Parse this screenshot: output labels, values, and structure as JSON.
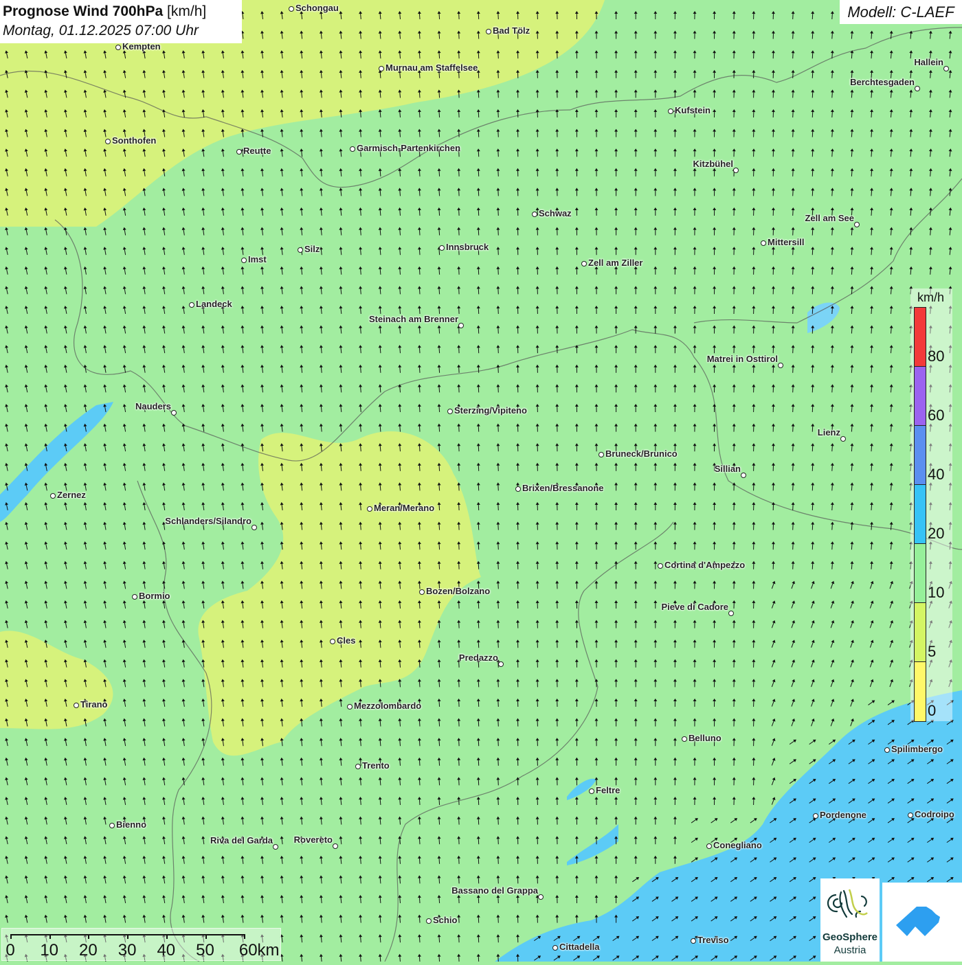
{
  "header": {
    "title_bold": "Prognose Wind 700hPa",
    "title_unit": "[km/h]",
    "datetime": "Montag, 01.12.2025 07:00 Uhr",
    "model": "Modell: C-LAEF"
  },
  "colors": {
    "base_green": "#a2eda0",
    "yellow_green": "#d6f27c",
    "blue": "#5ccbf6",
    "lake": "#3fa8f0",
    "arrow": "#111111"
  },
  "legend": {
    "unit": "km/h",
    "ticks": [
      "80",
      "60",
      "40",
      "20",
      "10",
      "5",
      "0"
    ],
    "colors": [
      "#f33a3a",
      "#9b63f0",
      "#5b8ff0",
      "#36c3f6",
      "#96f09a",
      "#d4f564",
      "#fff869"
    ]
  },
  "scale": {
    "labels": [
      "0",
      "10",
      "20",
      "30",
      "40",
      "50",
      "60km"
    ]
  },
  "cities": [
    "Schongau",
    "Bad Tölz",
    "Kempten",
    "Murnau am Staffelsee",
    "Hallein",
    "Berchtesgaden",
    "Kufstein",
    "Sonthofen",
    "Reutte",
    "Garmisch-Partenkirchen",
    "Kitzbühel",
    "Schwaz",
    "Zell am See",
    "Mittersill",
    "Silz",
    "Innsbruck",
    "Imst",
    "Zell am Ziller",
    "Landeck",
    "Steinach am Brenner",
    "Matrei in Osttirol",
    "Nauders",
    "Sterzing/Vipiteno",
    "Lienz",
    "Bruneck/Brunico",
    "Sillian",
    "Brixen/Bressanone",
    "Zernez",
    "Meran/Merano",
    "Schlanders/Silandro",
    "Cortina d'Ampezzo",
    "Bozen/Bolzano",
    "Bormio",
    "Pieve di Cadore",
    "Cles",
    "Predazzo",
    "Tirano",
    "Mezzolombardo",
    "Belluno",
    "Spilimbergo",
    "Trento",
    "Feltre",
    "Pordenone",
    "Codroipo",
    "Bienno",
    "Riva del Garda",
    "Rovereto",
    "Conegliano",
    "Bassano del Grappa",
    "Schio",
    "Treviso",
    "Cittadella"
  ],
  "logos": {
    "geosphere_line1": "GeoSphere",
    "geosphere_line2": "Austria"
  }
}
